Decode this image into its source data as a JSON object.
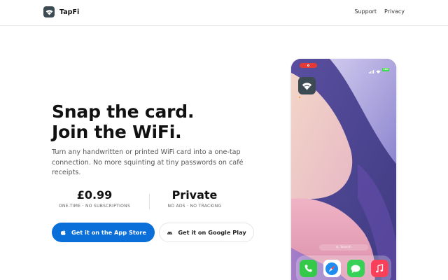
{
  "header": {
    "brand_name": "TapFi",
    "nav": [
      {
        "label": "Support"
      },
      {
        "label": "Privacy"
      }
    ]
  },
  "hero": {
    "headline_line1": "Snap the card.",
    "headline_line2": "Join the WiFi.",
    "subtext": "Turn any handwritten or printed WiFi card into a one-tap connection. No more squinting at tiny passwords on café receipts."
  },
  "stats": {
    "price": {
      "value": "£0.99",
      "label": "ONE-TIME · NO SUBSCRIPTIONS"
    },
    "privacy": {
      "value": "Private",
      "label": "NO ADS · NO TRACKING"
    }
  },
  "buttons": {
    "appstore_label": "Get it on the App Store",
    "google_label": "Get it on Google Play"
  },
  "phone": {
    "battery": "100",
    "search_label": "Search",
    "dock_apps": [
      "phone",
      "safari",
      "messages",
      "music"
    ]
  },
  "colors": {
    "accent": "#0a6fd8",
    "brand_icon_bg": "#3c4a54",
    "recording": "#e53935"
  },
  "icons": [
    "wifi-logo-icon",
    "apple-icon",
    "android-icon",
    "signal-icon",
    "wifi-icon",
    "battery-icon",
    "search-icon",
    "phone-icon",
    "safari-icon",
    "messages-icon",
    "music-icon"
  ]
}
